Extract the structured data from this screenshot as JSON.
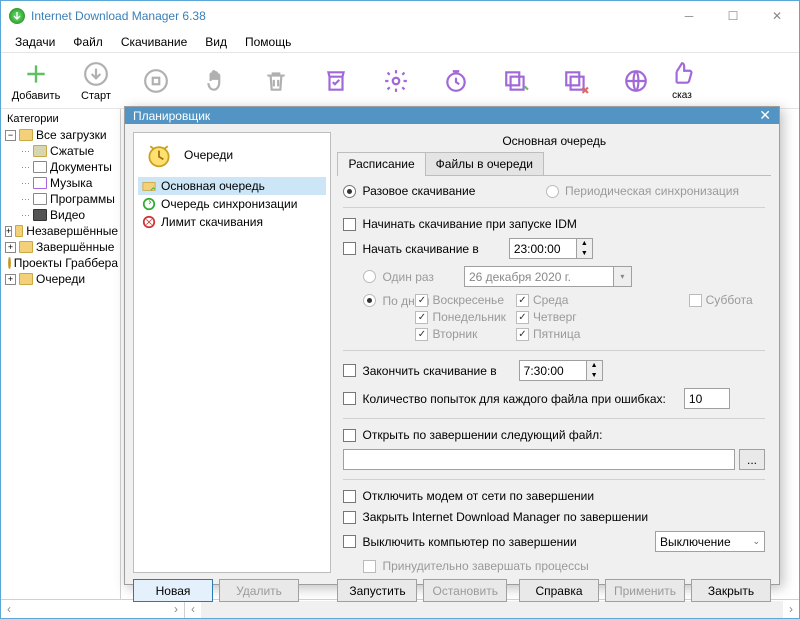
{
  "window": {
    "title": "Internet Download Manager 6.38"
  },
  "menu": [
    "Задачи",
    "Файл",
    "Скачивание",
    "Вид",
    "Помощь"
  ],
  "toolbar": {
    "add": "Добавить",
    "start": "Старт",
    "schedule_tip": "сказ"
  },
  "sidebar": {
    "header": "Категории",
    "all": "Все загрузки",
    "compressed": "Сжатые",
    "documents": "Документы",
    "music": "Музыка",
    "programs": "Программы",
    "video": "Видео",
    "unfinished": "Незавершённые",
    "finished": "Завершённые",
    "grabber": "Проекты Граббера",
    "queues": "Очереди"
  },
  "dialog": {
    "title": "Планировщик",
    "queues_header": "Очереди",
    "queues": {
      "main": "Основная очередь",
      "sync": "Очередь синхронизации",
      "limit": "Лимит скачивания"
    },
    "new_btn": "Новая",
    "delete_btn": "Удалить",
    "right_title": "Основная очередь",
    "tab_schedule": "Расписание",
    "tab_files": "Файлы в очереди",
    "one_time": "Разовое скачивание",
    "periodic": "Периодическая синхронизация",
    "start_on_launch": "Начинать скачивание при запуске IDM",
    "start_at": "Начать скачивание в",
    "start_time": "23:00:00",
    "once": "Один раз",
    "once_date": "26 декабря 2020 г.",
    "by_days": "По дням",
    "days": {
      "sun": "Воскресенье",
      "mon": "Понедельник",
      "tue": "Вторник",
      "wed": "Среда",
      "thu": "Четверг",
      "fri": "Пятница",
      "sat": "Суббота"
    },
    "stop_at": "Закончить скачивание в",
    "stop_time": "7:30:00",
    "retries": "Количество попыток для каждого файла при ошибках:",
    "retries_val": "10",
    "open_file": "Открыть по завершении следующий файл:",
    "browse": "...",
    "modem_off": "Отключить модем от сети по завершении",
    "close_idm": "Закрыть Internet Download Manager по завершении",
    "shutdown": "Выключить компьютер по завершении",
    "shutdown_mode": "Выключение",
    "force_kill": "Принудительно завершать процессы",
    "run": "Запустить",
    "stop": "Остановить",
    "help": "Справка",
    "apply": "Применить",
    "close": "Закрыть"
  }
}
